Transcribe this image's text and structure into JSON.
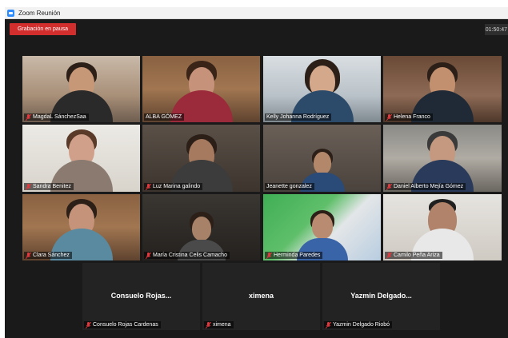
{
  "window": {
    "title": "Zoom Reunión"
  },
  "meeting": {
    "recording_status": "Grabación en pausa",
    "elapsed_time": "01:50:47"
  },
  "participants": [
    {
      "name": "MagdaL SánchezSaa"
    },
    {
      "name": "ALBA GÓMEZ"
    },
    {
      "name": "Kelly Johanna Rodríguez"
    },
    {
      "name": "Helena Franco"
    },
    {
      "name": "Sandra Benitez"
    },
    {
      "name": "Luz Marina galindo"
    },
    {
      "name": "Jeanette gonzalez"
    },
    {
      "name": "Daniel Alberto Mejía Gómez"
    },
    {
      "name": "Clara Sánchez"
    },
    {
      "name": "María Cristina Celis Camacho"
    },
    {
      "name": "Herminda Paredes"
    },
    {
      "name": "Camilo Peña Ariza"
    },
    {
      "name": "Consuelo Rojas Cardenas",
      "display_name": "Consuelo  Rojas..."
    },
    {
      "name": "ximena",
      "display_name": "ximena"
    },
    {
      "name": "Yazmin Delgado Riobó",
      "display_name": "Yazmin  Delgado..."
    }
  ],
  "colors": {
    "recording": "#d32e2e",
    "speaking_border": "#c8d84a",
    "muted_mic": "#e0393e"
  },
  "icons": {
    "app": "zoom-camera-icon",
    "muted": "mic-muted-icon"
  }
}
